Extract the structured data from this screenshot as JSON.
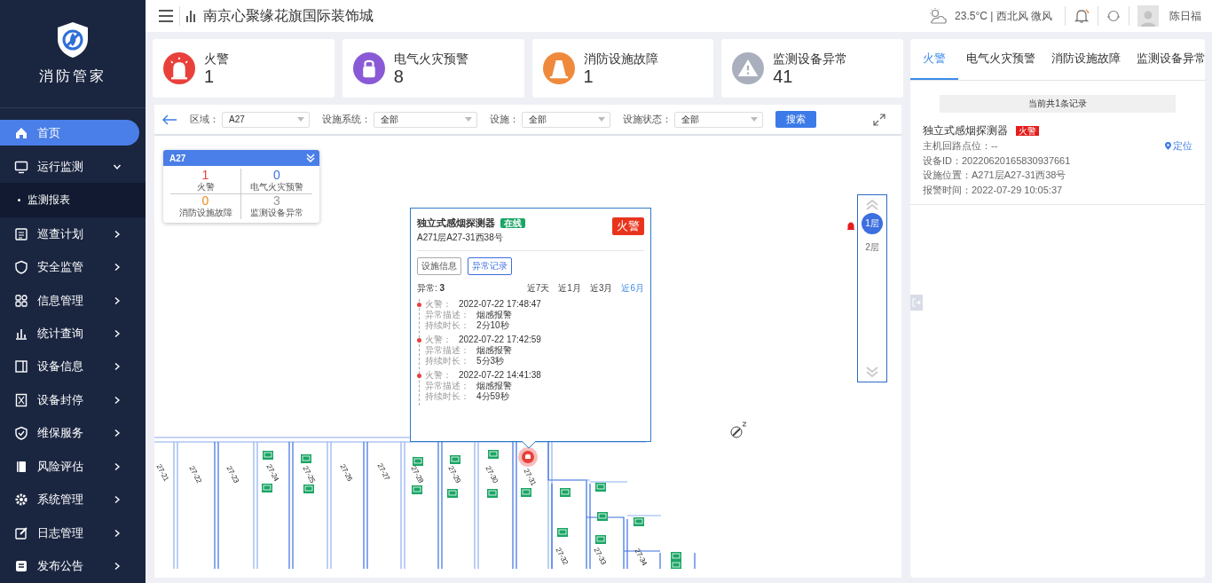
{
  "header": {
    "title": "南京心聚缘花旗国际装饰城",
    "weather": "23.5°C | 西北风 微风",
    "user": "陈日福"
  },
  "sidebar": {
    "brand": "消防管家",
    "items": [
      {
        "label": "首页",
        "kind": "link",
        "selected": true
      },
      {
        "label": "运行监测",
        "kind": "group",
        "selected": false,
        "expanded": true,
        "children": [
          {
            "label": "监测报表",
            "selected": false
          }
        ]
      },
      {
        "label": "巡查计划",
        "kind": "group",
        "selected": false,
        "expanded": false
      },
      {
        "label": "安全监管",
        "kind": "group",
        "selected": false,
        "expanded": false
      },
      {
        "label": "信息管理",
        "kind": "group",
        "selected": false,
        "expanded": false
      },
      {
        "label": "统计查询",
        "kind": "group",
        "selected": false,
        "expanded": false
      },
      {
        "label": "设备信息",
        "kind": "group",
        "selected": false,
        "expanded": false
      },
      {
        "label": "设备封停",
        "kind": "group",
        "selected": false,
        "expanded": false
      },
      {
        "label": "维保服务",
        "kind": "group",
        "selected": false,
        "expanded": false
      },
      {
        "label": "风险评估",
        "kind": "group",
        "selected": false,
        "expanded": false
      },
      {
        "label": "系统管理",
        "kind": "group",
        "selected": false,
        "expanded": false
      },
      {
        "label": "日志管理",
        "kind": "group",
        "selected": false,
        "expanded": false
      },
      {
        "label": "发布公告",
        "kind": "group",
        "selected": false,
        "expanded": false
      }
    ]
  },
  "stats": [
    {
      "label": "火警",
      "count": "1",
      "color": "#e8413c"
    },
    {
      "label": "电气火灾预警",
      "count": "8",
      "color": "#8a5ad6"
    },
    {
      "label": "消防设施故障",
      "count": "1",
      "color": "#ef8a3c"
    },
    {
      "label": "监测设备异常",
      "count": "41",
      "color": "#a9afbd"
    }
  ],
  "map": {
    "filters": [
      {
        "label": "区域：",
        "value": "A27"
      },
      {
        "label": "设施系统：",
        "value": "全部"
      },
      {
        "label": "设施：",
        "value": "全部"
      },
      {
        "label": "设施状态：",
        "value": "全部"
      }
    ],
    "search": "搜索",
    "area_card": {
      "title": "A27",
      "cells": [
        {
          "count": "1",
          "label": "火警",
          "color": "#e8413c"
        },
        {
          "count": "0",
          "label": "电气火灾预警",
          "color": "#3c6fe0"
        },
        {
          "count": "0",
          "label": "消防设施故障",
          "color": "#ef8a1c"
        },
        {
          "count": "3",
          "label": "监测设备异常",
          "color": "#999999"
        }
      ]
    },
    "units": [
      "27-21",
      "27-22",
      "27-23",
      "27-24",
      "27-25",
      "27-26",
      "27-27",
      "27-28",
      "27-29",
      "27-30",
      "27-31",
      "27-32",
      "27-33",
      "27-34"
    ],
    "popup": {
      "name": "独立式感烟探测器",
      "status": "在线",
      "address": "A271层A27-31西38号",
      "alert": "火警",
      "tabs": [
        {
          "label": "设施信息",
          "selected": false
        },
        {
          "label": "异常记录",
          "selected": true
        }
      ],
      "count_label": "异常:",
      "count": "3",
      "ranges": [
        {
          "label": "近7天",
          "selected": false
        },
        {
          "label": "近1月",
          "selected": false
        },
        {
          "label": "近3月",
          "selected": false
        },
        {
          "label": "近6月",
          "selected": true
        }
      ],
      "records": [
        {
          "type": "火警：",
          "time": "2022-07-22 17:48:47",
          "lines": [
            {
              "label": "异常描述：",
              "value": "烟感报警"
            },
            {
              "label": "持续时长：",
              "value": "2分10秒"
            }
          ]
        },
        {
          "type": "火警：",
          "time": "2022-07-22 17:42:59",
          "lines": [
            {
              "label": "异常描述：",
              "value": "烟感报警"
            },
            {
              "label": "持续时长：",
              "value": "5分3秒"
            }
          ]
        },
        {
          "type": "火警：",
          "time": "2022-07-22 14:41:38",
          "lines": [
            {
              "label": "异常描述：",
              "value": "烟感报警"
            },
            {
              "label": "持续时长：",
              "value": "4分59秒"
            }
          ]
        }
      ]
    },
    "floors": [
      {
        "label": "1层",
        "selected": true,
        "alarm": true
      },
      {
        "label": "2层",
        "selected": false,
        "alarm": false
      }
    ]
  },
  "alarm_panel": {
    "tabs": [
      {
        "label": "火警",
        "selected": true
      },
      {
        "label": "电气火灾预警",
        "selected": false
      },
      {
        "label": "消防设施故障",
        "selected": false
      },
      {
        "label": "监测设备异常",
        "selected": false
      }
    ],
    "summary": "当前共1条记录",
    "records": [
      {
        "name": "独立式感烟探测器",
        "tag": "火警",
        "locate": "定位",
        "lines": [
          "主机回路点位：--",
          "设备ID：20220620165830937661",
          "设施位置：A271层A27-31西38号",
          "报警时间：2022-07-29 10:05:37"
        ]
      }
    ]
  }
}
